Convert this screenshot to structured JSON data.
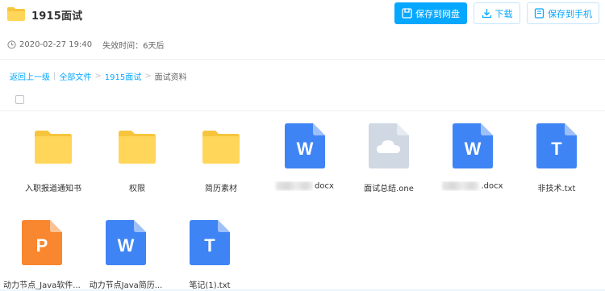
{
  "header": {
    "title": "1915面试",
    "buttons": {
      "save_to_cloud": "保存到网盘",
      "download": "下载",
      "save_to_phone": "保存到手机"
    }
  },
  "meta": {
    "datetime": "2020-02-27 19:40",
    "expire": "失效时间：6天后"
  },
  "breadcrumb": {
    "back": "返回上一级",
    "separator": "|",
    "all_files": "全部文件",
    "folder": "1915面试",
    "current": "面试资料",
    "arrow": ">"
  },
  "files": [
    {
      "name": "入职报道通知书",
      "type": "folder",
      "icon": "folder-icon"
    },
    {
      "name": "权限",
      "type": "folder",
      "icon": "folder-icon"
    },
    {
      "name": "简历素材",
      "type": "folder",
      "icon": "folder-icon"
    },
    {
      "name": "docx",
      "type": "word",
      "icon": "word-file-icon",
      "letter": "W",
      "blurred": true
    },
    {
      "name": "面试总结.one",
      "type": "cloud",
      "icon": "cloud-file-icon"
    },
    {
      "name": ".docx",
      "type": "word",
      "icon": "word-file-icon",
      "letter": "W",
      "blurred": true
    },
    {
      "name": "非技术.txt",
      "type": "text",
      "icon": "text-file-icon",
      "letter": "T"
    },
    {
      "name": "动力节点_Java软件...",
      "type": "ppt",
      "icon": "ppt-file-icon",
      "letter": "P"
    },
    {
      "name": "动力节点Java简历...",
      "type": "word",
      "icon": "word-file-icon",
      "letter": "W"
    },
    {
      "name": "笔记(1).txt",
      "type": "text",
      "icon": "text-file-icon",
      "letter": "T"
    }
  ],
  "colors": {
    "accent": "#06a7ff",
    "folder": "#ffd659",
    "folder_tab": "#f7c53c",
    "word": "#3f84f5",
    "word_fold": "#9ec0f9",
    "text": "#3f84f5",
    "ppt": "#f8872f",
    "ppt_fold": "#fbc294",
    "cloud": "#cfd8e3",
    "cloud_fold": "#e6ebf1"
  }
}
